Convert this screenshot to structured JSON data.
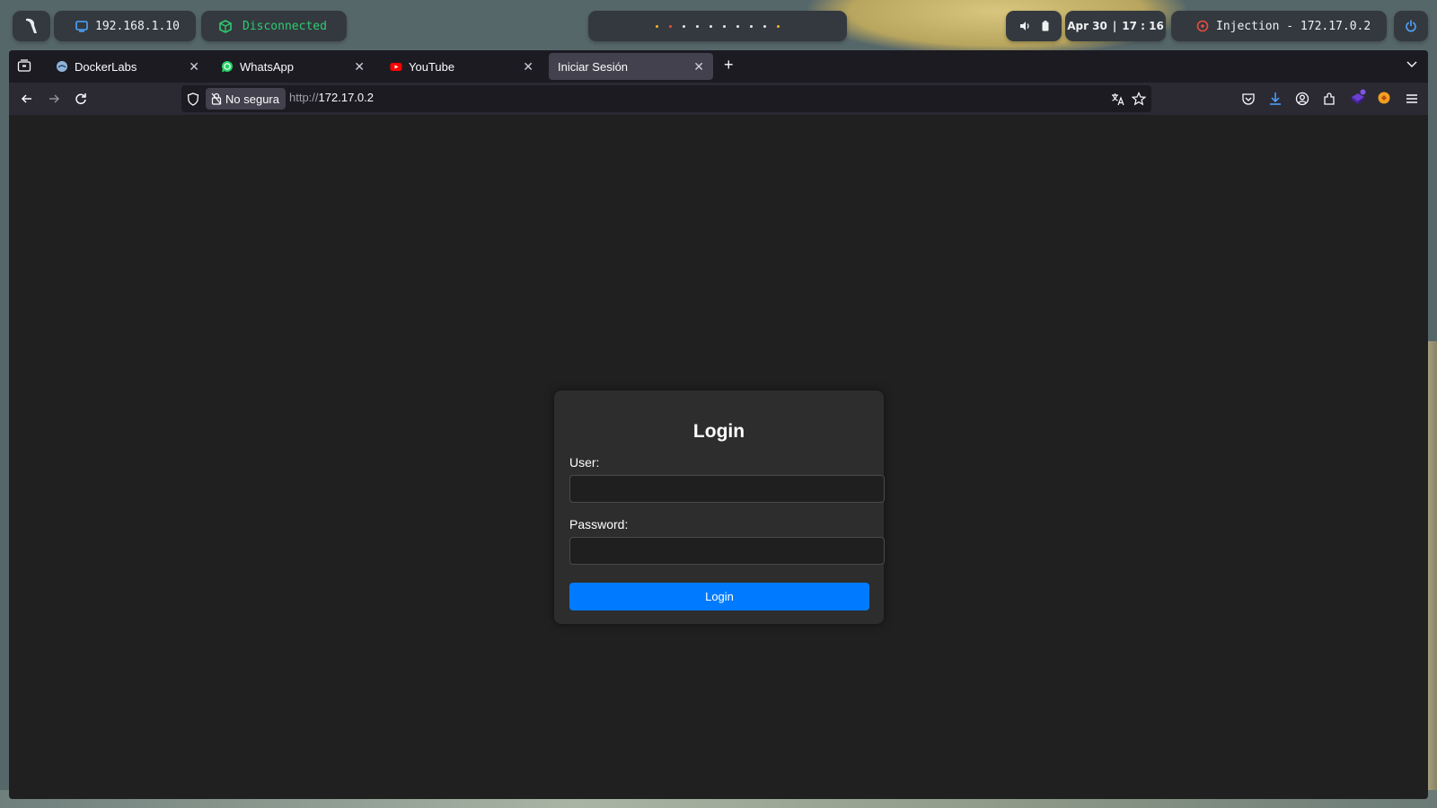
{
  "topbar": {
    "local_ip": "192.168.1.10",
    "vpn_status": "Disconnected",
    "date": "Apr 30",
    "time": "17 : 16",
    "date_separator": "|",
    "target": "Injection - 172.17.0.2",
    "workspace_dot_colors": [
      "#f0b429",
      "#e74c3c",
      "#e6e6e6",
      "#e6e6e6",
      "#e6e6e6",
      "#e6e6e6",
      "#e6e6e6",
      "#e6e6e6",
      "#e6e6e6",
      "#f0b429"
    ],
    "colors": {
      "vpn": "#2ecc71",
      "target_icon": "#e74c3c",
      "power": "#4da3ff"
    }
  },
  "browser": {
    "tabs": [
      {
        "label": "DockerLabs",
        "icon": "dockerlabs-favicon"
      },
      {
        "label": "WhatsApp",
        "icon": "whatsapp-favicon"
      },
      {
        "label": "YouTube",
        "icon": "youtube-favicon"
      },
      {
        "label": "Iniciar Sesión",
        "icon": "none",
        "active": true
      }
    ],
    "new_tab": "+",
    "security_label": "No segura",
    "url_scheme": "http://",
    "url_host": "172.17.0.2"
  },
  "login": {
    "title": "Login",
    "user_label": "User:",
    "user_value": "",
    "password_label": "Password:",
    "password_value": "",
    "submit_label": "Login",
    "accent": "#007bff"
  }
}
